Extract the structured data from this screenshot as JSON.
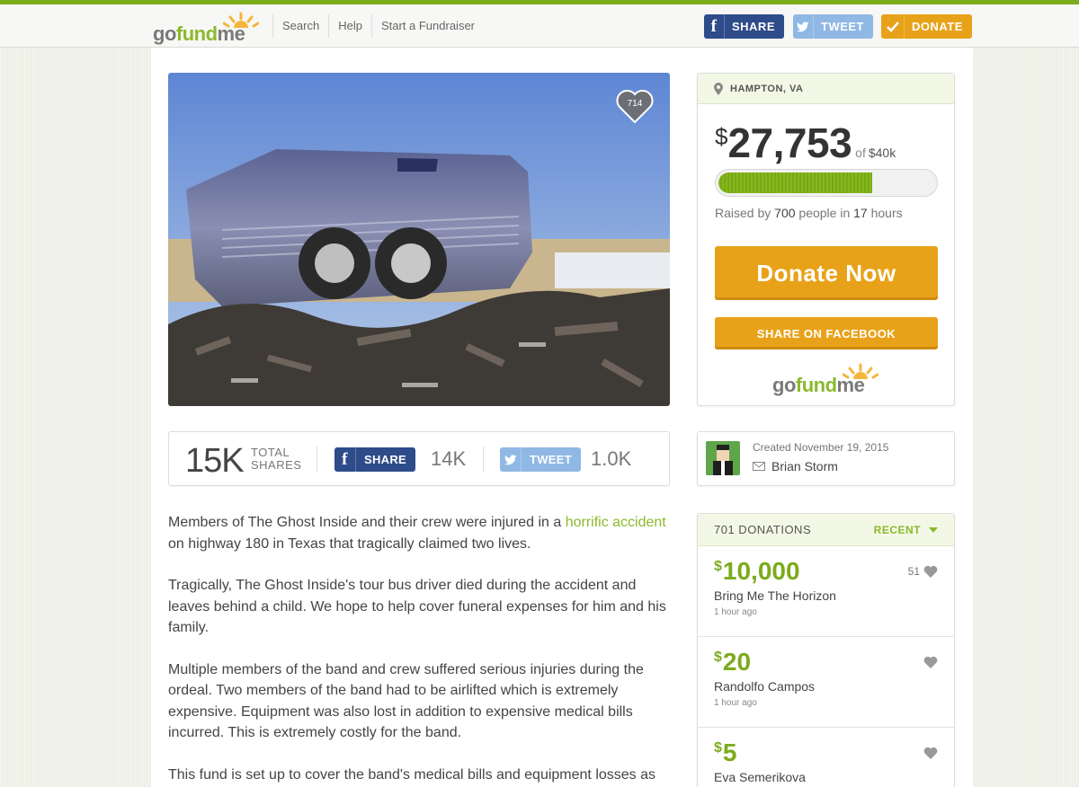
{
  "header": {
    "logo": "gofundme",
    "nav": [
      "Search",
      "Help",
      "Start a Fundraiser"
    ],
    "share_label": "SHARE",
    "tweet_label": "TWEET",
    "donate_label": "DONATE"
  },
  "hero": {
    "heart_count": "714"
  },
  "sharebar": {
    "total_shares": "15K",
    "total_label_1": "TOTAL",
    "total_label_2": "SHARES",
    "fb_label": "SHARE",
    "fb_count": "14K",
    "tw_label": "TWEET",
    "tw_count": "1.0K"
  },
  "story": {
    "p1_before": "Members of The Ghost Inside and their crew were injured in a ",
    "p1_link": "horrific accident",
    "p1_after": " on highway 180 in Texas that tragically claimed two lives.",
    "p2": "Tragically, The Ghost Inside's tour bus driver died during the accident and leaves behind a child. We hope to help cover funeral expenses for him and his family.",
    "p3": "Multiple members of the band and crew suffered serious injuries during the ordeal. Two members of the band had to be airlifted which is extremely expensive. Equipment was also lost in addition to expensive medical bills incurred. This is extremely costly for the band.",
    "p4": "This fund is set up to cover the band's medical bills and equipment losses as"
  },
  "campaign": {
    "location": "HAMPTON, VA",
    "currency": "$",
    "raised": "27,753",
    "of_label": "of",
    "goal": "$40k",
    "progress_fraction": 0.694,
    "raised_by_prefix": "Raised by",
    "people": "700",
    "people_label": "people in",
    "hours": "17",
    "hours_label": "hours",
    "donate_now": "Donate Now",
    "share_facebook": "SHARE ON FACEBOOK",
    "card_logo": "gofundme"
  },
  "creator": {
    "created": "Created November 19, 2015",
    "name": "Brian Storm"
  },
  "donations": {
    "count_label": "701 DONATIONS",
    "sort_label": "RECENT",
    "items": [
      {
        "symbol": "$",
        "amount": "10,000",
        "name": "Bring Me The Horizon",
        "time": "1 hour ago",
        "likes": "51"
      },
      {
        "symbol": "$",
        "amount": "20",
        "name": "Randolfo Campos",
        "time": "1 hour ago",
        "likes": ""
      },
      {
        "symbol": "$",
        "amount": "5",
        "name": "Eva Semerikova",
        "time": "",
        "likes": ""
      }
    ]
  },
  "colors": {
    "brand_green": "#7cab1c",
    "donate_orange": "#e8a219",
    "facebook_blue": "#2e4b8a",
    "twitter_blue": "#8fb8e4"
  }
}
